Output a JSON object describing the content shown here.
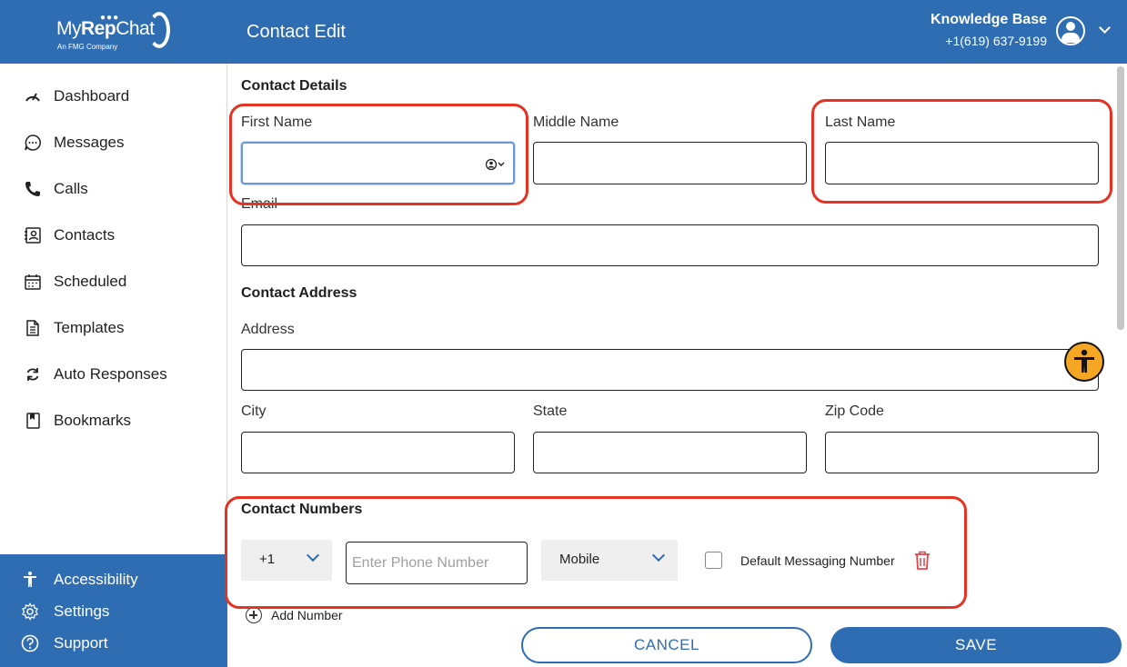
{
  "logo": {
    "my": "My",
    "rep": "Rep",
    "chat": "Chat",
    "sub": "An FMG Company"
  },
  "header": {
    "title": "Contact Edit",
    "account_name": "Knowledge Base",
    "account_phone": "+1(619) 637-9199"
  },
  "nav": [
    {
      "label": "Dashboard",
      "icon": "speedometer-icon"
    },
    {
      "label": "Messages",
      "icon": "chat-bubble-icon"
    },
    {
      "label": "Calls",
      "icon": "phone-icon"
    },
    {
      "label": "Contacts",
      "icon": "contact-card-icon"
    },
    {
      "label": "Scheduled",
      "icon": "calendar-icon"
    },
    {
      "label": "Templates",
      "icon": "document-icon"
    },
    {
      "label": "Auto Responses",
      "icon": "refresh-icon"
    },
    {
      "label": "Bookmarks",
      "icon": "bookmark-icon"
    }
  ],
  "bottom_nav": [
    {
      "label": "Accessibility",
      "icon": "accessibility-icon"
    },
    {
      "label": "Settings",
      "icon": "gear-icon"
    },
    {
      "label": "Support",
      "icon": "help-icon"
    }
  ],
  "form": {
    "details_title": "Contact Details",
    "first_name_label": "First Name",
    "middle_name_label": "Middle Name",
    "last_name_label": "Last Name",
    "email_label": "Email",
    "first_name_value": "",
    "middle_name_value": "",
    "last_name_value": "",
    "email_value": "",
    "address_title": "Contact Address",
    "address_label": "Address",
    "city_label": "City",
    "state_label": "State",
    "zip_label": "Zip Code",
    "numbers_title": "Contact Numbers",
    "country_code": "+1",
    "phone_placeholder": "Enter Phone Number",
    "phone_type": "Mobile",
    "default_messaging_label": "Default Messaging Number",
    "default_messaging_checked": false,
    "add_number_label": "Add Number"
  },
  "actions": {
    "cancel": "CANCEL",
    "save": "SAVE"
  },
  "colors": {
    "brand": "#2f6db3",
    "highlight": "#e53222",
    "delete": "#e0474c",
    "a11y": "#f5a623"
  }
}
